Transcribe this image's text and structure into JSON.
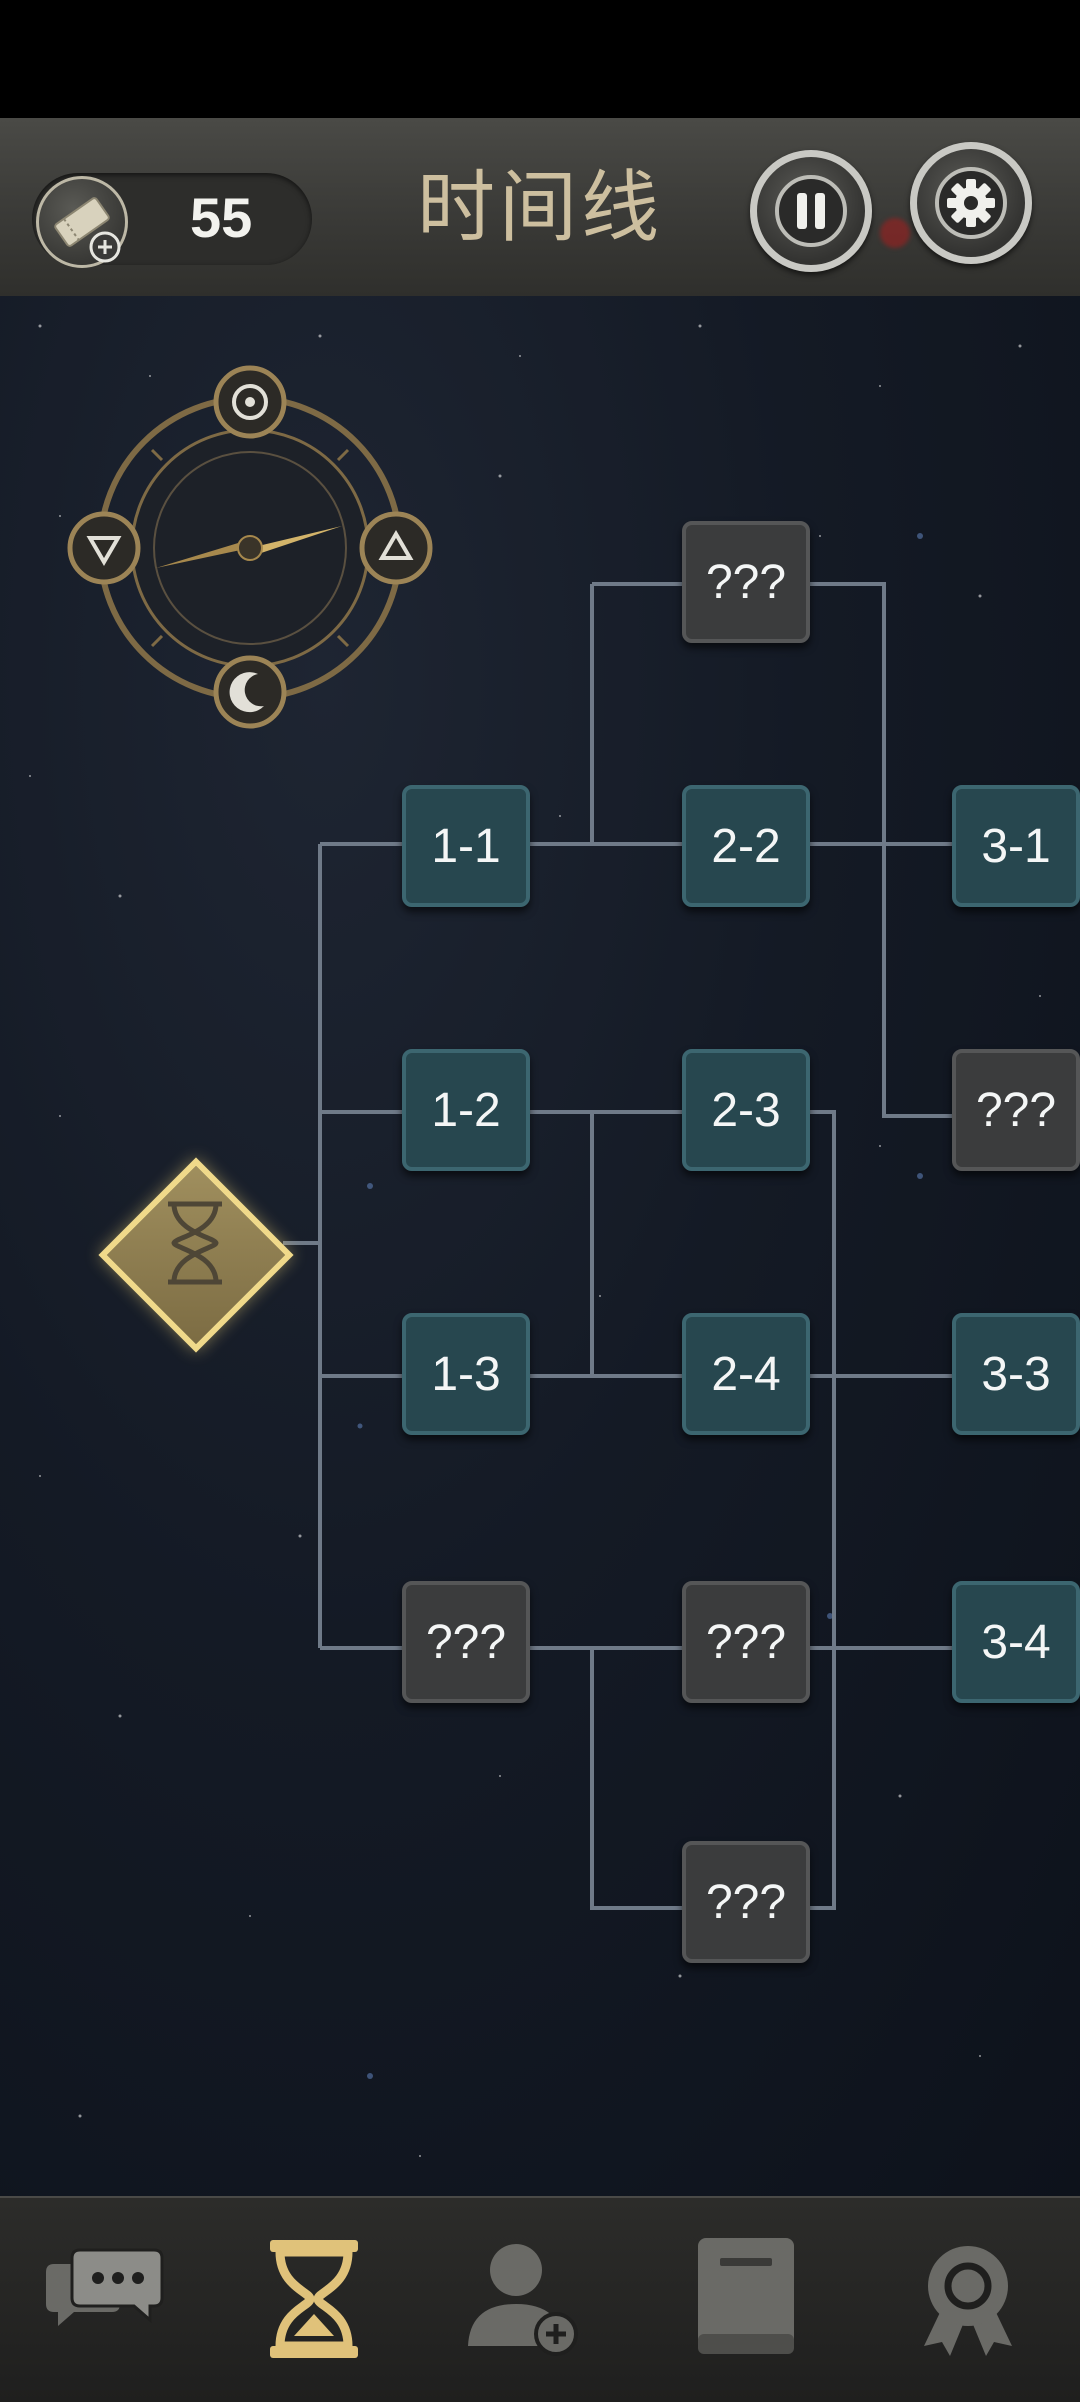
{
  "header": {
    "title": "时间线",
    "ticket_count": "55"
  },
  "compass": {
    "top_symbol": "target",
    "left_symbol": "triangle-down",
    "right_symbol": "triangle-up",
    "bottom_symbol": "moon"
  },
  "timeline": {
    "start_icon": "hourglass-icon",
    "nodes": [
      {
        "id": "n-unk-top",
        "label": "???",
        "state": "locked"
      },
      {
        "id": "n-1-1",
        "label": "1-1",
        "state": "open"
      },
      {
        "id": "n-2-2",
        "label": "2-2",
        "state": "open"
      },
      {
        "id": "n-3-1",
        "label": "3-1",
        "state": "open"
      },
      {
        "id": "n-1-2",
        "label": "1-2",
        "state": "open"
      },
      {
        "id": "n-2-3",
        "label": "2-3",
        "state": "open"
      },
      {
        "id": "n-unk-r",
        "label": "???",
        "state": "locked"
      },
      {
        "id": "n-1-3",
        "label": "1-3",
        "state": "open"
      },
      {
        "id": "n-2-4",
        "label": "2-4",
        "state": "open"
      },
      {
        "id": "n-3-3",
        "label": "3-3",
        "state": "open"
      },
      {
        "id": "n-unk-l4",
        "label": "???",
        "state": "locked"
      },
      {
        "id": "n-unk-m4",
        "label": "???",
        "state": "locked"
      },
      {
        "id": "n-3-4",
        "label": "3-4",
        "state": "open"
      },
      {
        "id": "n-unk-bot",
        "label": "???",
        "state": "locked"
      }
    ]
  },
  "bottom_nav": {
    "items": [
      {
        "icon": "chat-icon",
        "active": false
      },
      {
        "icon": "hourglass-icon",
        "active": true
      },
      {
        "icon": "add-user-icon",
        "active": false
      },
      {
        "icon": "book-icon",
        "active": false
      },
      {
        "icon": "achievement-icon",
        "active": false
      }
    ]
  },
  "colors": {
    "accent_gold": "#d9b86a",
    "node_open": "#27474f",
    "node_locked": "#3b3c3d",
    "line": "#6f7a88"
  }
}
